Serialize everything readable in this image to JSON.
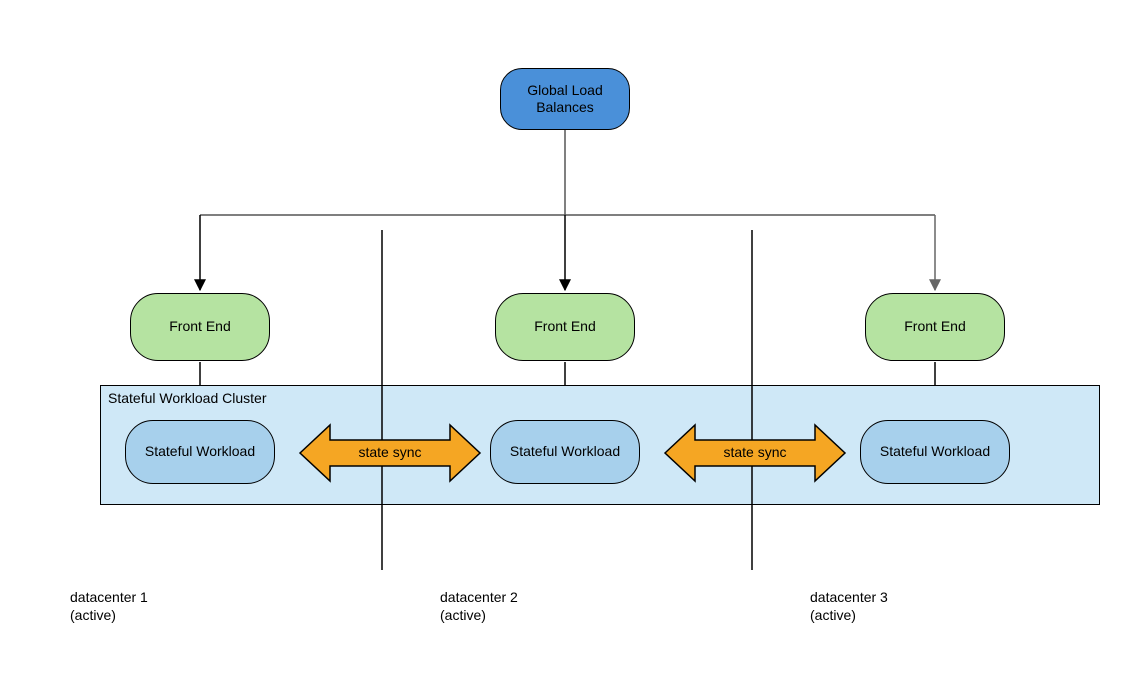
{
  "nodes": {
    "lb": {
      "label": "Global Load\nBalances"
    },
    "fe1": {
      "label": "Front End"
    },
    "fe2": {
      "label": "Front End"
    },
    "fe3": {
      "label": "Front End"
    },
    "sw1": {
      "label": "Stateful Workload"
    },
    "sw2": {
      "label": "Stateful Workload"
    },
    "sw3": {
      "label": "Stateful Workload"
    }
  },
  "cluster": {
    "title": "Stateful Workload Cluster"
  },
  "sync": {
    "left": {
      "label": "state sync"
    },
    "right": {
      "label": "state sync"
    }
  },
  "datacenters": {
    "dc1": "datacenter 1\n(active)",
    "dc2": "datacenter 2\n(active)",
    "dc3": "datacenter 3\n(active)"
  },
  "colors": {
    "lb": "#4A90D9",
    "fe": "#B5E3A1",
    "sw": "#A7D0EC",
    "cluster": "#CFE8F7",
    "sync": "#F5A623"
  }
}
